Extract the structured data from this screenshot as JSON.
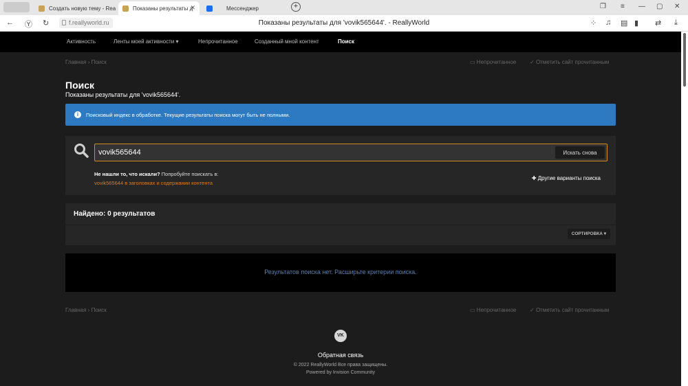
{
  "browser": {
    "tabs": [
      {
        "label": "Создать новую тему - Rea",
        "active": false
      },
      {
        "label": "Показаны результаты д",
        "active": true
      },
      {
        "label": "Мессенджер",
        "active": false
      }
    ],
    "new_tab": "+",
    "url": "f.reallyworld.ru",
    "page_title": "Показаны результаты для 'vovik565644'. - ReallyWorld"
  },
  "nav": {
    "items": [
      "Активность",
      "Ленты моей активности ▾",
      "Непрочитанное",
      "Созданный мной контент",
      "Поиск"
    ]
  },
  "breadcrumb": {
    "home": "Главная",
    "sep": "›",
    "current": "Поиск"
  },
  "actions": {
    "unread": "Непрочитанное",
    "mark_read": "Отметить сайт прочитанным"
  },
  "page": {
    "title": "Поиск",
    "subtitle": "Показаны результаты для 'vovik565644'."
  },
  "info_message": "Поисковый индекс в обработке. Текущие результаты поиска могут быть не полными.",
  "search": {
    "value": "vovik565644",
    "button": "Искать снова",
    "not_found_bold": "Не нашли то, что искали?",
    "not_found_rest": " Попробуйте поискать в:",
    "suggestion_link": "vovik565644 в заголовках и содержании контента",
    "more_options": "Другие варианты поиска"
  },
  "results": {
    "title": "Найдено: 0 результатов",
    "sort": "СОРТИРОВКА ▾",
    "empty": "Результатов поиска нет. Расширьте критерии поиска."
  },
  "footer": {
    "vk": "VK",
    "feedback": "Обратная связь",
    "copyright": "© 2022 ReallyWorld Все права защищены.",
    "powered": "Powered by Invision Community"
  },
  "colors": {
    "accent": "#2d7ac2",
    "link": "#e07b1a",
    "focus": "#d98a1f"
  }
}
